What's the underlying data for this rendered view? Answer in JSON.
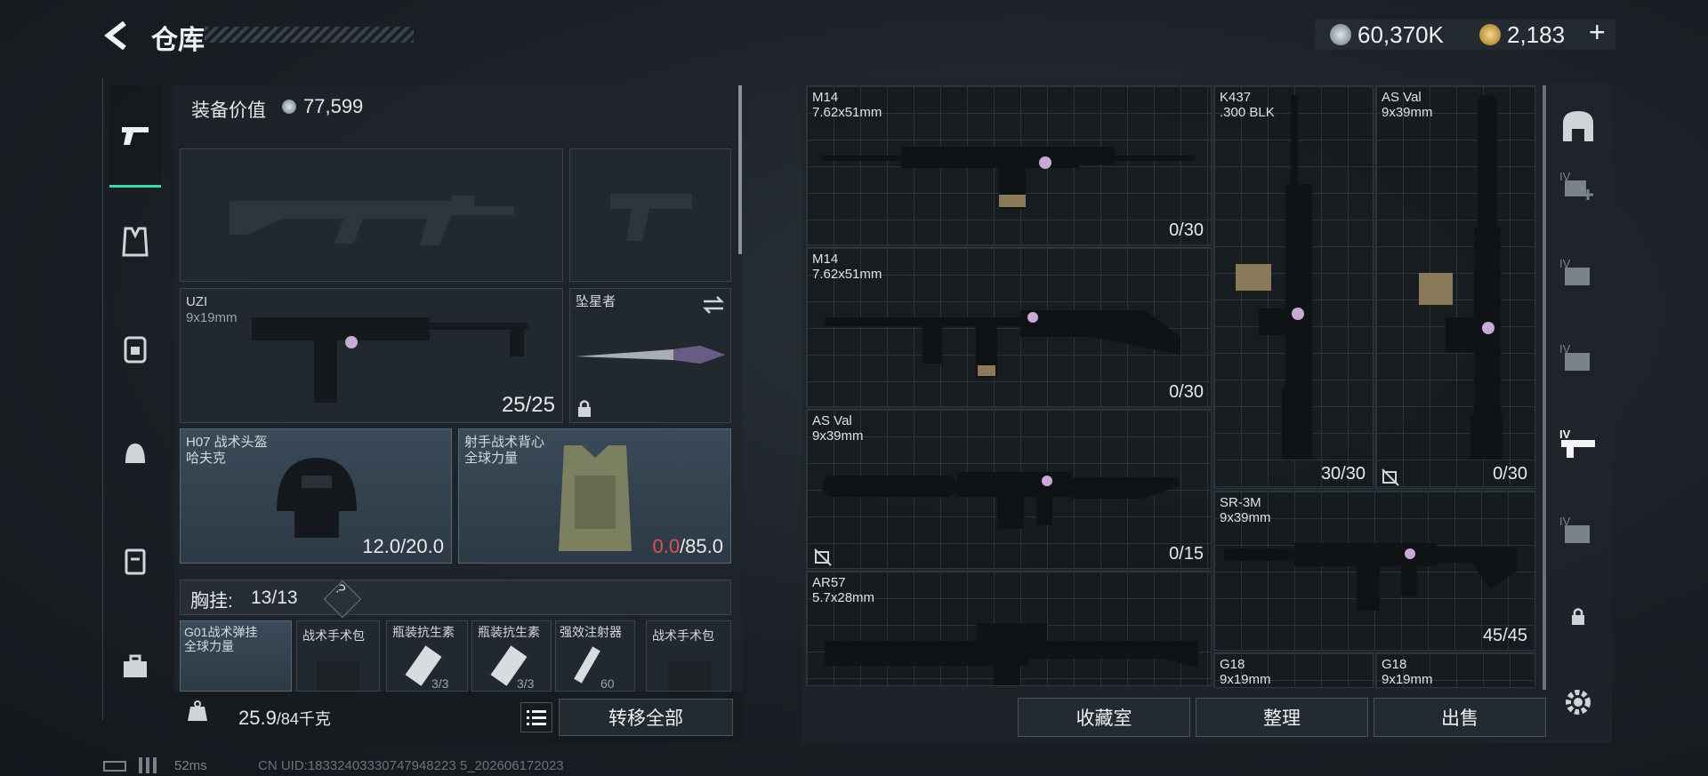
{
  "header": {
    "title": "仓库",
    "currency1": "60,370K",
    "currency2": "2,183",
    "plus": "+"
  },
  "loadout": {
    "value_label": "装备价值",
    "value": "77,599",
    "secondary_slot": {
      "name": "UZI",
      "caliber": "9x19mm",
      "count": "25/25"
    },
    "melee_slot": {
      "name": "坠星者"
    },
    "helmet": {
      "name": "H07 战术头盔",
      "brand": "哈夫克",
      "durability": "12.0/20.0"
    },
    "armor": {
      "name": "射手战术背心",
      "brand": "全球力量",
      "durability_cur": "0.0",
      "durability_max": "/85.0"
    },
    "chest_rig": {
      "label": "胸挂:",
      "count": "13/13",
      "help": "?"
    },
    "rig_items": [
      {
        "name": "G01战术弹挂",
        "sub": "全球力量"
      },
      {
        "name": "战术手术包",
        "sub": ""
      },
      {
        "name": "瓶装抗生素",
        "sub": "3/3"
      },
      {
        "name": "瓶装抗生素",
        "sub": "3/3"
      },
      {
        "name": "强效注射器",
        "sub": "60"
      },
      {
        "name": "战术手术包",
        "sub": ""
      }
    ],
    "weight_cur": "25.9",
    "weight_max": "/84千克",
    "transfer_all": "转移全部"
  },
  "storage": {
    "weapons": [
      {
        "name": "M14",
        "caliber": "7.62x51mm",
        "count": "0/30"
      },
      {
        "name": "M14",
        "caliber": "7.62x51mm",
        "count": "0/30"
      },
      {
        "name": "AS Val",
        "caliber": "9x39mm",
        "count": "0/15"
      },
      {
        "name": "AR57",
        "caliber": "5.7x28mm",
        "count": ""
      },
      {
        "name": "K437",
        "caliber": ".300 BLK",
        "count": "30/30"
      },
      {
        "name": "AS Val",
        "caliber": "9x39mm",
        "count": "0/30"
      },
      {
        "name": "SR-3M",
        "caliber": "9x39mm",
        "count": "45/45"
      },
      {
        "name": "G18",
        "caliber": "9x19mm",
        "count": ""
      },
      {
        "name": "G18",
        "caliber": "9x19mm",
        "count": ""
      }
    ],
    "buttons": {
      "collection": "收藏室",
      "sort": "整理",
      "sell": "出售"
    },
    "side_tabs": [
      "IV",
      "IV",
      "IV",
      "IV",
      "IV"
    ]
  },
  "footer": {
    "ping": "52ms",
    "uid": "CN UID:18332403330747948223 5_202606172023"
  }
}
